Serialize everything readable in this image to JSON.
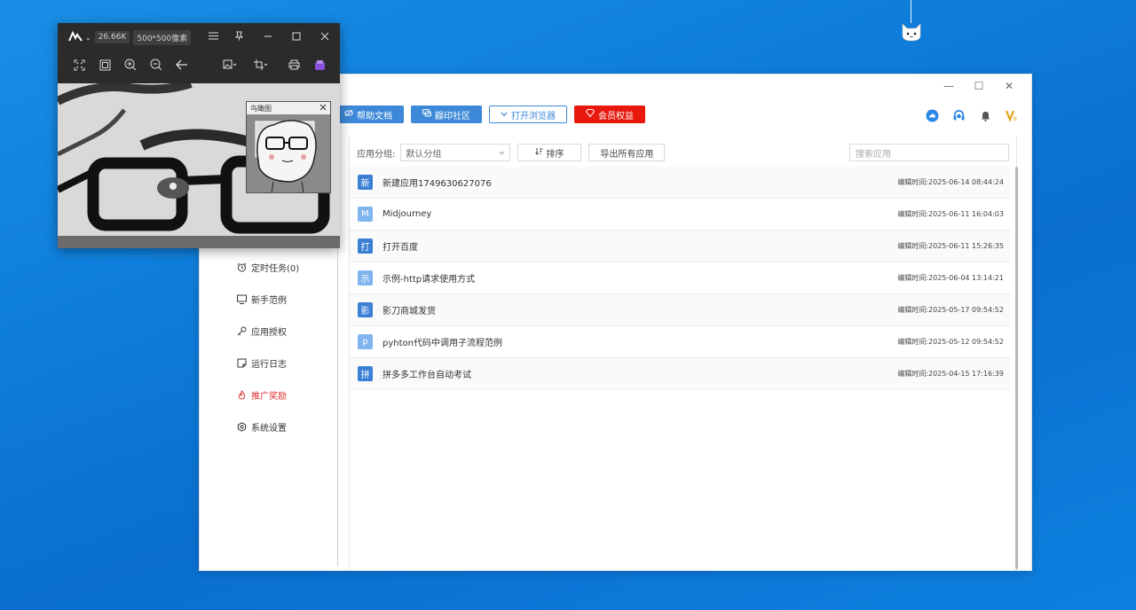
{
  "desktop": {
    "mascot_icon": "cat-face-icon"
  },
  "app": {
    "window_controls": [
      "—",
      "☐",
      "✕"
    ],
    "toolbar": [
      {
        "label": "帮助文档",
        "icon": "eye-slash-icon",
        "style": "primary"
      },
      {
        "label": "鼹印社区",
        "icon": "chat-icon",
        "style": "primary"
      },
      {
        "label": "打开浏览器",
        "icon": "chevron-down-icon",
        "style": "outline"
      },
      {
        "label": "会员权益",
        "icon": "diamond-icon",
        "style": "danger"
      }
    ],
    "toolbar_right_icons": [
      "cloud-icon",
      "headset-icon",
      "bell-icon",
      "vip-icon"
    ],
    "sidebar": {
      "items": [
        {
          "label": "定时任务(0)",
          "icon": "alarm-clock-icon",
          "active": false
        },
        {
          "label": "新手范例",
          "icon": "monitor-icon",
          "active": false
        },
        {
          "label": "应用授权",
          "icon": "key-icon",
          "active": false
        },
        {
          "label": "运行日志",
          "icon": "log-icon",
          "active": false
        },
        {
          "label": "推广奖励",
          "icon": "fire-icon",
          "active": true
        },
        {
          "label": "系统设置",
          "icon": "gear-icon",
          "active": false
        }
      ]
    },
    "filter": {
      "group_label": "应用分组:",
      "group_value": "默认分组",
      "sort_label": "排序",
      "export_label": "导出所有应用",
      "search_placeholder": "搜索应用"
    },
    "apps": [
      {
        "badge": "新",
        "name": "新建应用1749630627076",
        "time": "编辑时间:2025-06-14 08:44:24",
        "tone": "dark"
      },
      {
        "badge": "M",
        "name": "Midjourney",
        "time": "编辑时间:2025-06-11 16:04:03",
        "tone": "light"
      },
      {
        "badge": "打",
        "name": "打开百度",
        "time": "编辑时间:2025-06-11 15:26:35",
        "tone": "dark"
      },
      {
        "badge": "示",
        "name": "示例-http请求使用方式",
        "time": "编辑时间:2025-06-04 13:14:21",
        "tone": "light"
      },
      {
        "badge": "影",
        "name": "影刀商城发货",
        "time": "编辑时间:2025-05-17 09:54:52",
        "tone": "dark"
      },
      {
        "badge": "p",
        "name": "pyhton代码中调用子流程范例",
        "time": "编辑时间:2025-05-12 09:54:52",
        "tone": "light"
      },
      {
        "badge": "拼",
        "name": "拼多多工作台自动考试",
        "time": "编辑时间:2025-04-15 17:16:39",
        "tone": "dark"
      }
    ]
  },
  "viewer": {
    "file_size": "26.66K",
    "dimensions": "500*500像素",
    "birdseye_title": "鸟瞰图",
    "tools": [
      "fit-screen-icon",
      "actual-size-icon",
      "zoom-in-icon",
      "zoom-out-icon",
      "back-arrow-icon",
      "image-menu-icon",
      "crop-icon",
      "print-icon",
      "app-icon"
    ]
  }
}
